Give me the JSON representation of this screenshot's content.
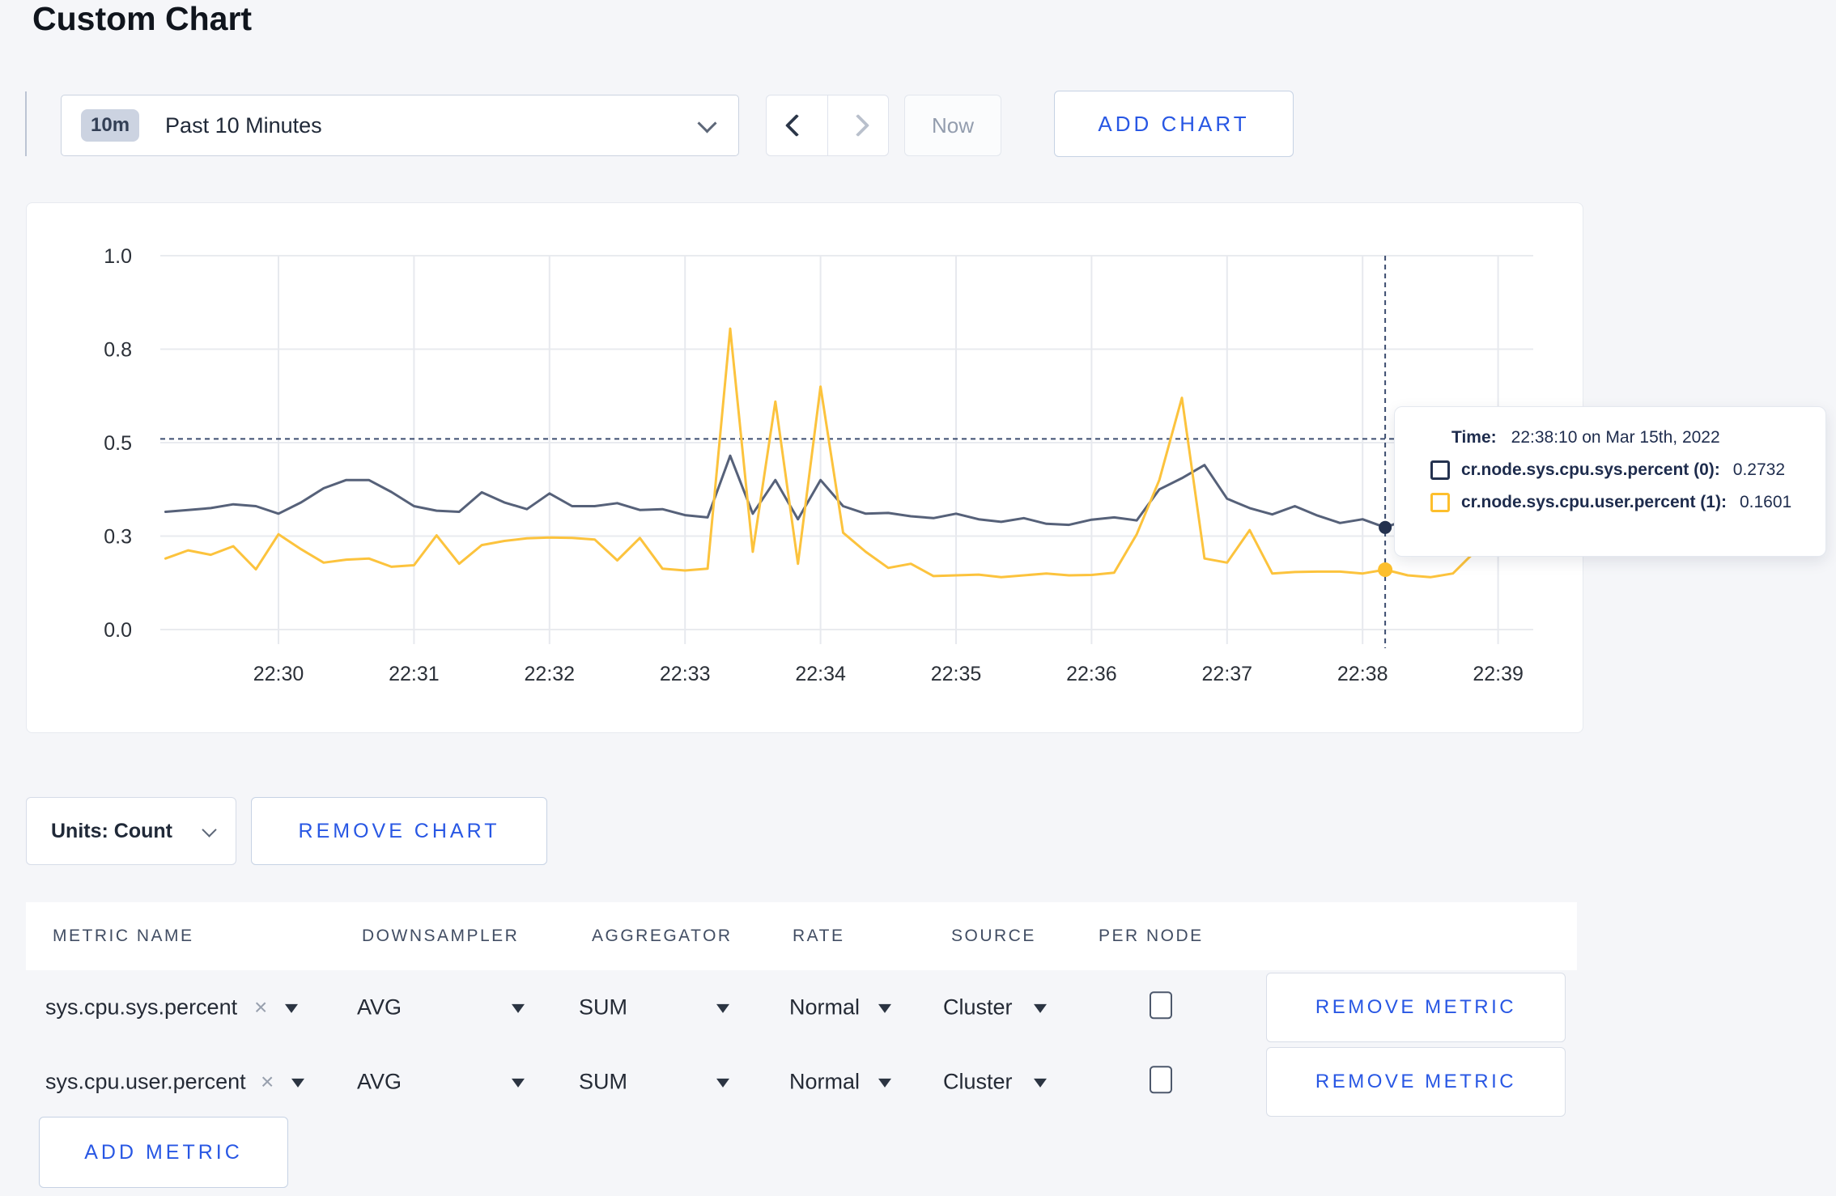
{
  "page": {
    "title": "Custom Chart"
  },
  "colors": {
    "accent_blue": "#2857e4",
    "navy": "#1e2c4d",
    "series_sys": "#566179",
    "series_user": "#fcc33d",
    "crosshair": "#3c4d70",
    "grid": "#e9ebef"
  },
  "toolbar": {
    "time_range": {
      "badge": "10m",
      "label": "Past 10 Minutes"
    },
    "now_label": "Now",
    "add_chart_label": "ADD CHART"
  },
  "chart_data": {
    "type": "line",
    "title": "",
    "xlabel": "",
    "ylabel": "",
    "ylim": [
      0,
      1
    ],
    "grid": true,
    "legend_position": "tooltip",
    "y_ticks": [
      {
        "label": "0.0",
        "value": 0.0
      },
      {
        "label": "0.3",
        "value": 0.25
      },
      {
        "label": "0.5",
        "value": 0.5
      },
      {
        "label": "0.8",
        "value": 0.75
      },
      {
        "label": "1.0",
        "value": 1.0
      }
    ],
    "x_ticks": [
      "22:30",
      "22:31",
      "22:32",
      "22:33",
      "22:34",
      "22:35",
      "22:36",
      "22:37",
      "22:38",
      "22:39"
    ],
    "times": [
      "22:29:10",
      "22:29:20",
      "22:29:30",
      "22:29:40",
      "22:29:50",
      "22:30:00",
      "22:30:10",
      "22:30:20",
      "22:30:30",
      "22:30:40",
      "22:30:50",
      "22:31:00",
      "22:31:10",
      "22:31:20",
      "22:31:30",
      "22:31:40",
      "22:31:50",
      "22:32:00",
      "22:32:10",
      "22:32:20",
      "22:32:30",
      "22:32:40",
      "22:32:50",
      "22:33:00",
      "22:33:10",
      "22:33:20",
      "22:33:30",
      "22:33:40",
      "22:33:50",
      "22:34:00",
      "22:34:10",
      "22:34:20",
      "22:34:30",
      "22:34:40",
      "22:34:50",
      "22:35:00",
      "22:35:10",
      "22:35:20",
      "22:35:30",
      "22:35:40",
      "22:35:50",
      "22:36:00",
      "22:36:10",
      "22:36:20",
      "22:36:30",
      "22:36:40",
      "22:36:50",
      "22:37:00",
      "22:37:10",
      "22:37:20",
      "22:37:30",
      "22:37:40",
      "22:37:50",
      "22:38:00",
      "22:38:10",
      "22:38:20",
      "22:38:30",
      "22:38:40",
      "22:38:50",
      "22:39:00",
      "22:39:10"
    ],
    "series": [
      {
        "name": "cr.node.sys.cpu.sys.percent",
        "color": "#566179",
        "values": [
          0.315,
          0.32,
          0.325,
          0.335,
          0.33,
          0.31,
          0.34,
          0.378,
          0.4,
          0.4,
          0.368,
          0.33,
          0.318,
          0.315,
          0.367,
          0.34,
          0.322,
          0.364,
          0.33,
          0.33,
          0.338,
          0.32,
          0.322,
          0.306,
          0.3,
          0.465,
          0.31,
          0.4,
          0.295,
          0.4,
          0.33,
          0.31,
          0.312,
          0.303,
          0.298,
          0.31,
          0.295,
          0.288,
          0.298,
          0.283,
          0.28,
          0.294,
          0.3,
          0.292,
          0.375,
          0.405,
          0.44,
          0.35,
          0.325,
          0.308,
          0.33,
          0.305,
          0.285,
          0.295,
          0.2732,
          0.295,
          0.3,
          0.298,
          0.3,
          0.296,
          0.3
        ]
      },
      {
        "name": "cr.node.sys.cpu.user.percent",
        "color": "#fcc33d",
        "values": [
          0.19,
          0.212,
          0.2,
          0.223,
          0.161,
          0.255,
          0.215,
          0.179,
          0.187,
          0.19,
          0.168,
          0.172,
          0.252,
          0.176,
          0.226,
          0.237,
          0.244,
          0.246,
          0.245,
          0.241,
          0.185,
          0.245,
          0.163,
          0.158,
          0.163,
          0.805,
          0.208,
          0.61,
          0.176,
          0.65,
          0.259,
          0.208,
          0.165,
          0.176,
          0.143,
          0.145,
          0.147,
          0.14,
          0.145,
          0.15,
          0.145,
          0.146,
          0.152,
          0.255,
          0.4,
          0.62,
          0.19,
          0.179,
          0.266,
          0.15,
          0.154,
          0.155,
          0.155,
          0.15,
          0.1601,
          0.145,
          0.14,
          0.15,
          0.21,
          0.285,
          0.255
        ]
      }
    ],
    "crosshair": {
      "time": "22:38:10",
      "y_value": 0.51
    }
  },
  "tooltip": {
    "time_label": "Time:",
    "time_value": "22:38:10 on Mar 15th, 2022",
    "rows": [
      {
        "name": "cr.node.sys.cpu.sys.percent (0):",
        "value": "0.2732",
        "color": "#24324f"
      },
      {
        "name": "cr.node.sys.cpu.user.percent (1):",
        "value": "0.1601",
        "color": "#fdbf2d"
      }
    ]
  },
  "chart_footer": {
    "units_label": "Units: Count",
    "remove_chart_label": "REMOVE CHART"
  },
  "metrics_table": {
    "headers": [
      "METRIC NAME",
      "DOWNSAMPLER",
      "AGGREGATOR",
      "RATE",
      "SOURCE",
      "PER NODE"
    ],
    "rows": [
      {
        "name": "sys.cpu.sys.percent",
        "downsampler": "AVG",
        "aggregator": "SUM",
        "rate": "Normal",
        "source": "Cluster",
        "per_node_checked": false,
        "remove_label": "REMOVE METRIC"
      },
      {
        "name": "sys.cpu.user.percent",
        "downsampler": "AVG",
        "aggregator": "SUM",
        "rate": "Normal",
        "source": "Cluster",
        "per_node_checked": false,
        "remove_label": "REMOVE METRIC"
      }
    ],
    "add_metric_label": "ADD METRIC"
  }
}
